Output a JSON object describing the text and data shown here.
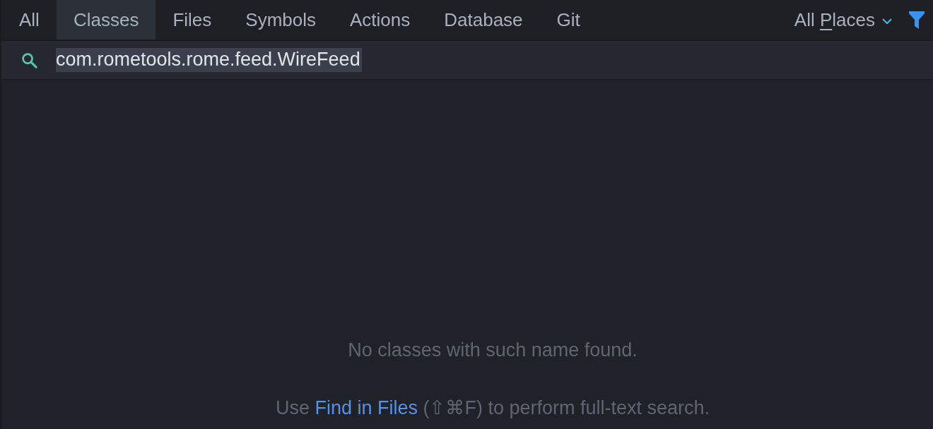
{
  "tabs": [
    {
      "label": "All",
      "selected": false
    },
    {
      "label": "Classes",
      "selected": true
    },
    {
      "label": "Files",
      "selected": false
    },
    {
      "label": "Symbols",
      "selected": false
    },
    {
      "label": "Actions",
      "selected": false
    },
    {
      "label": "Database",
      "selected": false
    },
    {
      "label": "Git",
      "selected": false
    }
  ],
  "scope": {
    "label_parts": [
      {
        "text": "All ",
        "underlined": false
      },
      {
        "text": "P",
        "underlined": true
      },
      {
        "text": "laces",
        "underlined": false
      }
    ]
  },
  "search": {
    "value": "com.rometools.rome.feed.WireFeed",
    "text_selected": true
  },
  "empty_state": {
    "message": "No classes with such name found.",
    "hint_before": "Use ",
    "hint_link": "Find in Files",
    "hint_after": " (⇧⌘F) to perform full-text search."
  }
}
